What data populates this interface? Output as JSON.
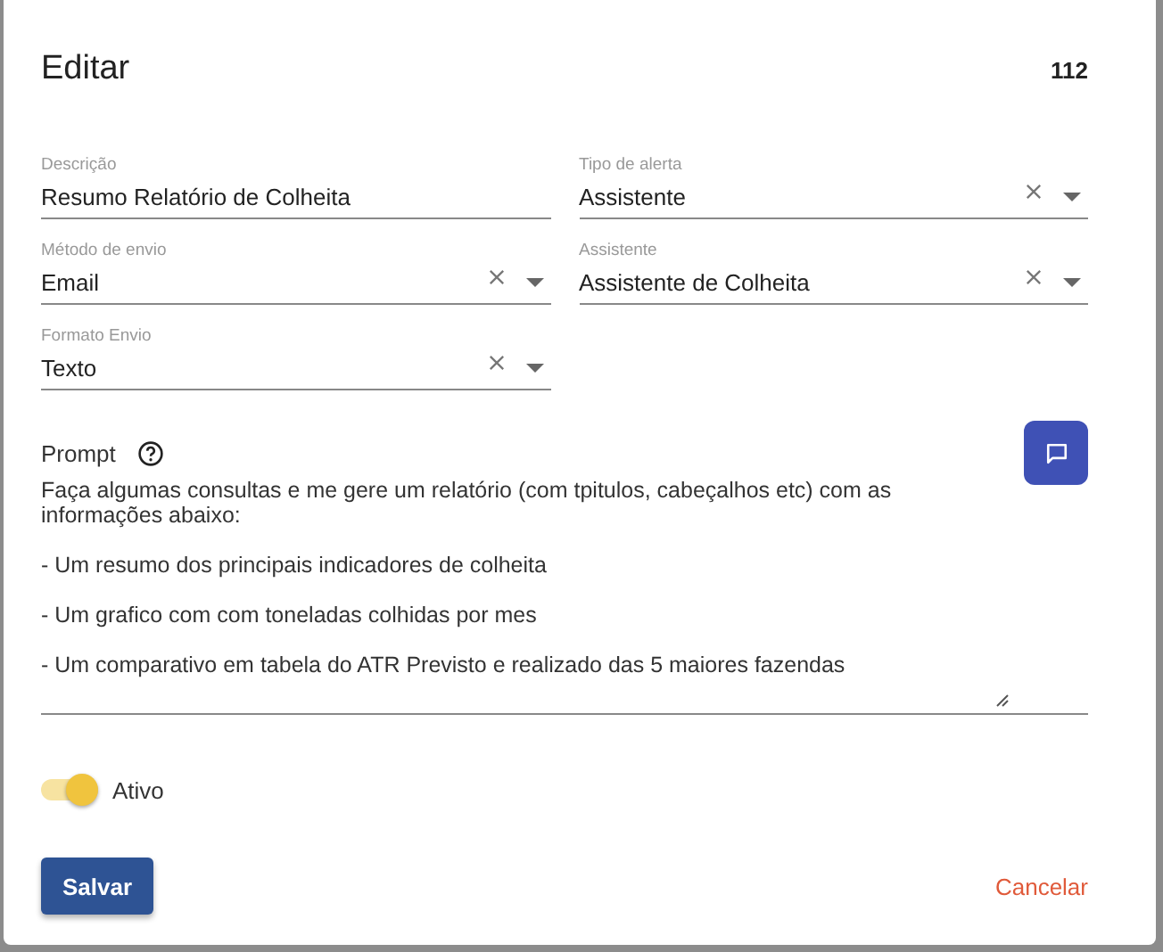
{
  "dialog": {
    "title": "Editar",
    "record_number": "112"
  },
  "fields": [
    {
      "label": "Descrição",
      "value": "Resumo Relatório de Colheita",
      "kind": "text"
    },
    {
      "label": "Tipo de alerta",
      "value": "Assistente",
      "kind": "select"
    },
    {
      "label": "Método de envio",
      "value": "Email",
      "kind": "select"
    },
    {
      "label": "Assistente",
      "value": "Assistente de Colheita",
      "kind": "select"
    },
    {
      "label": "Formato Envio",
      "value": "Texto",
      "kind": "select"
    }
  ],
  "prompt": {
    "label": "Prompt",
    "value": "Faça algumas consultas e me gere um relatório (com tpitulos, cabeçalhos etc) com as informações abaixo:\n\n- Um resumo dos principais indicadores de colheita\n\n- Um grafico com com toneladas colhidas por mes\n\n- Um comparativo em tabela do ATR Previsto e realizado das 5 maiores fazendas"
  },
  "active_toggle": {
    "label": "Ativo",
    "on": true
  },
  "buttons": {
    "save": "Salvar",
    "cancel": "Cancelar"
  }
}
